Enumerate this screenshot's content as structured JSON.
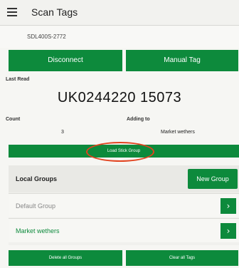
{
  "topbar": {
    "title": "Scan Tags",
    "menu_icon": "hamburger-menu-icon"
  },
  "reader": {
    "id": "SDL400S-2772"
  },
  "actions": {
    "disconnect_label": "Disconnect",
    "manual_tag_label": "Manual Tag"
  },
  "last_read": {
    "label": "Last Read",
    "tag": "UK0244220 15073"
  },
  "count": {
    "label": "Count",
    "value": "3"
  },
  "adding_to": {
    "label": "Adding to",
    "value": "Market wethers"
  },
  "load_stick_group_label": "Load Stick Group",
  "groups": {
    "title": "Local Groups",
    "new_group_label": "New Group",
    "items": [
      {
        "name": "Default Group",
        "chevron": "chevron-right-icon"
      },
      {
        "name": "Market wethers",
        "chevron": "chevron-right-icon"
      }
    ]
  },
  "footer": {
    "delete_all_label": "Delete all Groups",
    "clear_all_label": "Clear all Tags"
  },
  "colors": {
    "primary_green": "#0d8a3c",
    "highlight_red": "#e2431f",
    "group_active_text": "#0d8a3c",
    "group_inactive_text": "#888888"
  }
}
